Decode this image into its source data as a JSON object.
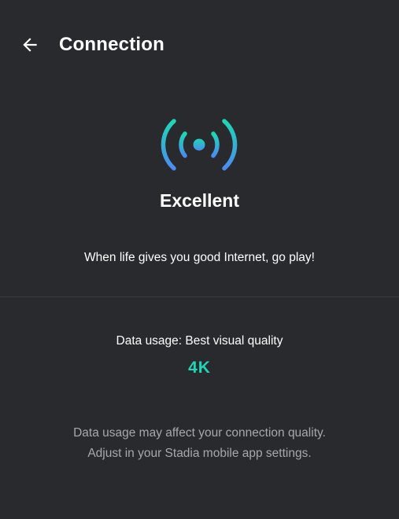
{
  "header": {
    "title": "Connection",
    "back_icon": "arrow-left-icon"
  },
  "status": {
    "icon": "signal-broadcast-icon",
    "label": "Excellent",
    "tagline": "When life gives you good Internet, go play!"
  },
  "data_usage": {
    "label": "Data usage: Best visual quality",
    "resolution": "4K"
  },
  "note": {
    "line1": "Data usage may affect your connection quality.",
    "line2": "Adjust in your Stadia mobile app settings."
  },
  "colors": {
    "background": "#292a2d",
    "accent": "#1fd6b4",
    "gradient_top": "#1fd6b4",
    "gradient_bottom": "#4a8cf0",
    "muted_text": "#a6a8ab"
  }
}
